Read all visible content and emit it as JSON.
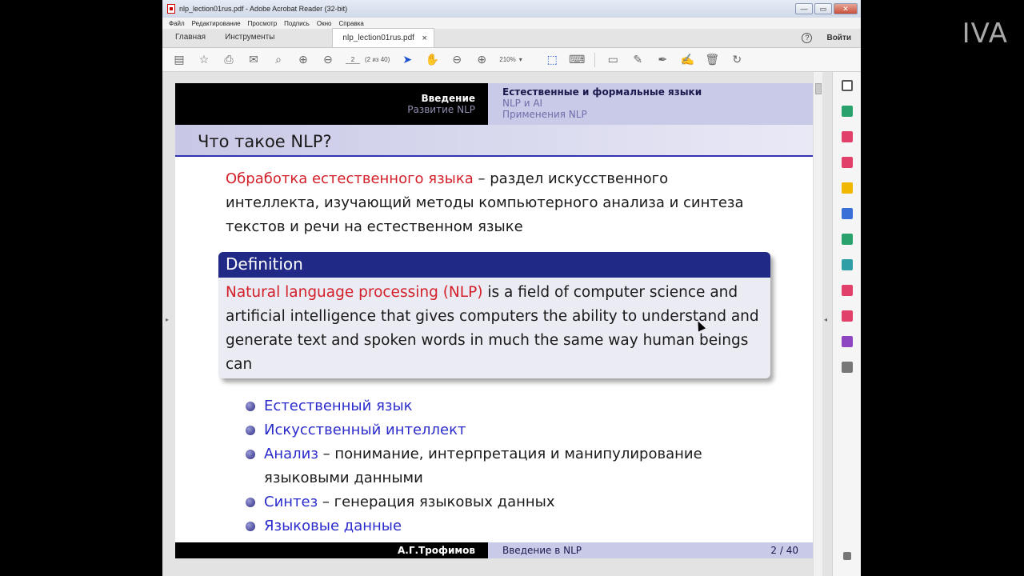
{
  "watermark": "IVA",
  "window": {
    "title": "nlp_lection01rus.pdf - Adobe Acrobat Reader (32-bit)",
    "controls": [
      "—",
      "▭",
      "✕"
    ]
  },
  "menu": [
    "Файл",
    "Редактирование",
    "Просмотр",
    "Подпись",
    "Окно",
    "Справка"
  ],
  "tabs": {
    "home": "Главная",
    "tools": "Инструменты",
    "doc": "nlp_lection01rus.pdf",
    "close": "×",
    "signin": "Войти",
    "help": "?"
  },
  "toolbar": {
    "page_current": "2",
    "page_total": "(2 из 40)",
    "zoom": "210%",
    "icons": [
      "save-icon",
      "star-icon",
      "print-icon",
      "mail-icon",
      "search-icon",
      "page-up-icon",
      "page-down-icon",
      "select-arrow-icon",
      "hand-icon",
      "zoom-out-icon",
      "zoom-in-icon",
      "marquee-icon",
      "keyboard-icon",
      "comment-icon",
      "highlight-icon",
      "sign-icon",
      "edit-icon",
      "delete-icon",
      "rotate-icon"
    ]
  },
  "slide": {
    "header": {
      "section": "Введение",
      "subsection": "Развитие NLP",
      "nav_items": [
        "Естественные и формальные языки",
        "NLP и AI",
        "Применения NLP"
      ]
    },
    "frame_title": "Что такое NLP?",
    "intro": {
      "term": "Обработка естественного языка",
      "rest": " – раздел искусственного интеллекта, изучающий методы компьютерного анализа и синтеза текстов и речи на естественном языке"
    },
    "definition": {
      "title": "Definition",
      "term": "Natural language processing (NLP)",
      "rest": " is a field of computer science and artificial intelligence that gives computers the ability to understand and generate text and spoken words in much the same way human beings can"
    },
    "bullets": [
      {
        "term": "Естественный язык",
        "rest": ""
      },
      {
        "term": "Искусственный интеллект",
        "rest": ""
      },
      {
        "term": "Анализ",
        "rest": " – понимание, интерпретация и манипулирование языковыми данными"
      },
      {
        "term": "Синтез",
        "rest": " – генерация языковых данных"
      },
      {
        "term": "Языковые данные",
        "rest": ""
      }
    ],
    "footer": {
      "author": "А.Г.Трофимов",
      "title": "Введение в NLP",
      "page": "2 / 40"
    }
  },
  "colors": {
    "accent_red": "#d4202a",
    "accent_blue": "#2b2bcc",
    "block_header": "#202a86",
    "beamer_lavender": "#c9c9e8"
  }
}
